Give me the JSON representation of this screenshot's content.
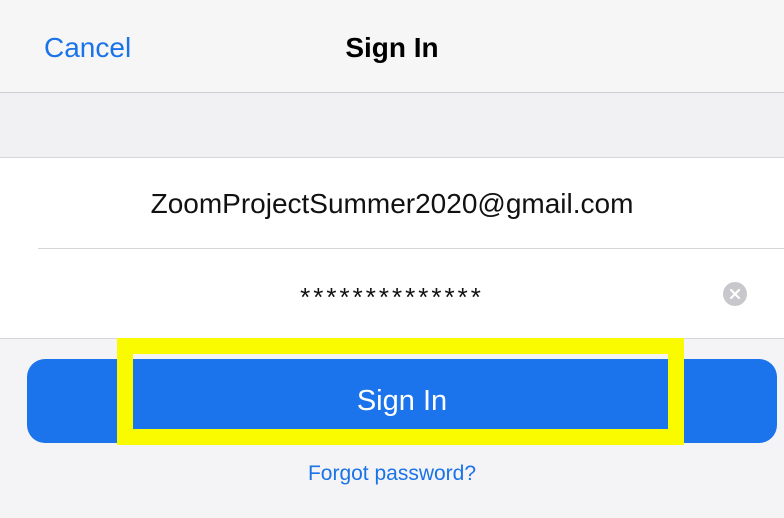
{
  "header": {
    "cancel_label": "Cancel",
    "title": "Sign In"
  },
  "form": {
    "email_value": "ZoomProjectSummer2020@gmail.com",
    "password_value": "**************",
    "clear_icon": "clear-circle-x-icon"
  },
  "actions": {
    "sign_in_label": "Sign In",
    "forgot_password_label": "Forgot password?"
  },
  "colors": {
    "accent": "#1a73e8",
    "button": "#1b74ec",
    "highlight": "#fbfb00"
  }
}
